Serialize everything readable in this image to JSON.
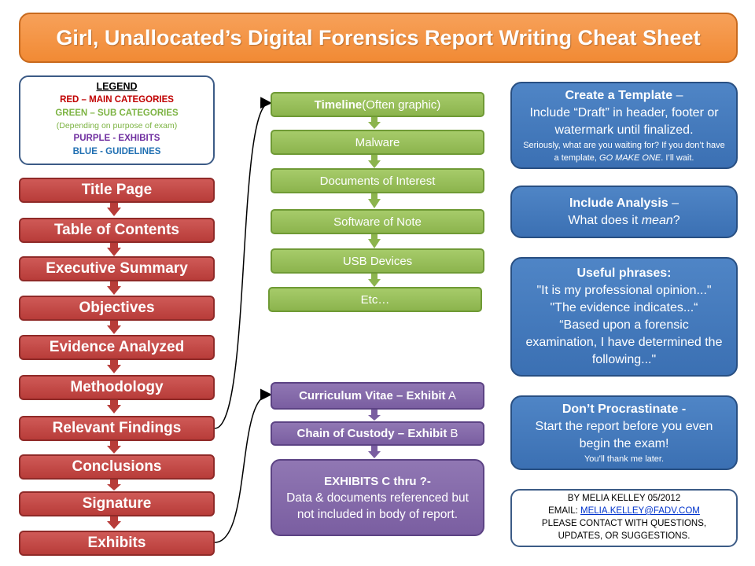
{
  "title": "Girl, Unallocated’s Digital Forensics Report Writing Cheat Sheet",
  "legend": {
    "heading": "LEGEND",
    "red": "RED – MAIN CATEGORIES",
    "green": "GREEN – SUB CATEGORIES",
    "green_note": "(Depending on purpose of exam)",
    "purple": "PURPLE - EXHIBITS",
    "blue": "BLUE - GUIDELINES"
  },
  "main_categories": [
    "Title Page",
    "Table of Contents",
    "Executive Summary",
    "Objectives",
    "Evidence Analyzed",
    "Methodology",
    "Relevant Findings",
    "Conclusions",
    "Signature",
    "Exhibits"
  ],
  "sub_categories": {
    "timeline_bold": "Timeline",
    "timeline_rest": " (Often graphic)",
    "items": [
      "Malware",
      "Documents of Interest",
      "Software of Note",
      "USB Devices",
      "Etc…"
    ]
  },
  "exhibits": {
    "cv_bold": "Curriculum Vitae – Exhibit",
    "cv_letter": " A",
    "coc_bold": "Chain of Custody – Exhibit",
    "coc_letter": " B",
    "rest_heading": "EXHIBITS C thru ?-",
    "rest_body": "Data & documents referenced but not included in body of report."
  },
  "guidelines": {
    "template": {
      "heading": "Create a Template",
      "heading_tail": " –",
      "body": "Include “Draft” in header, footer or watermark until finalized.",
      "note_1": "Seriously, what are you waiting for?  If you don’t have a template, ",
      "note_emph": "GO MAKE ONE",
      "note_2": ".  I’ll wait."
    },
    "analysis": {
      "heading": "Include Analysis",
      "heading_tail": " –",
      "body_1": "What does it ",
      "body_emph": "mean",
      "body_2": "?"
    },
    "phrases": {
      "heading": "Useful phrases:",
      "p1": "\"It is my professional opinion...\"",
      "p2": "\"The evidence indicates...“",
      "p3": "“Based upon a forensic examination, I have determined the following...\""
    },
    "procrastinate": {
      "heading": "Don’t Procrastinate -",
      "body": "Start the report before you even begin the exam!",
      "note": "You’ll thank me later."
    }
  },
  "credit": {
    "line1": "BY MELIA KELLEY 05/2012",
    "email_label": "EMAIL: ",
    "email": "MELIA.KELLEY@FADV.COM",
    "line3": "PLEASE CONTACT  WITH QUESTIONS,",
    "line4": "UPDATES, OR SUGGESTIONS."
  },
  "colors": {
    "title": "#f18a34",
    "main": "#b83c39",
    "sub": "#8cb44d",
    "exhibit": "#7a5ea1",
    "guideline": "#3b70b3"
  }
}
